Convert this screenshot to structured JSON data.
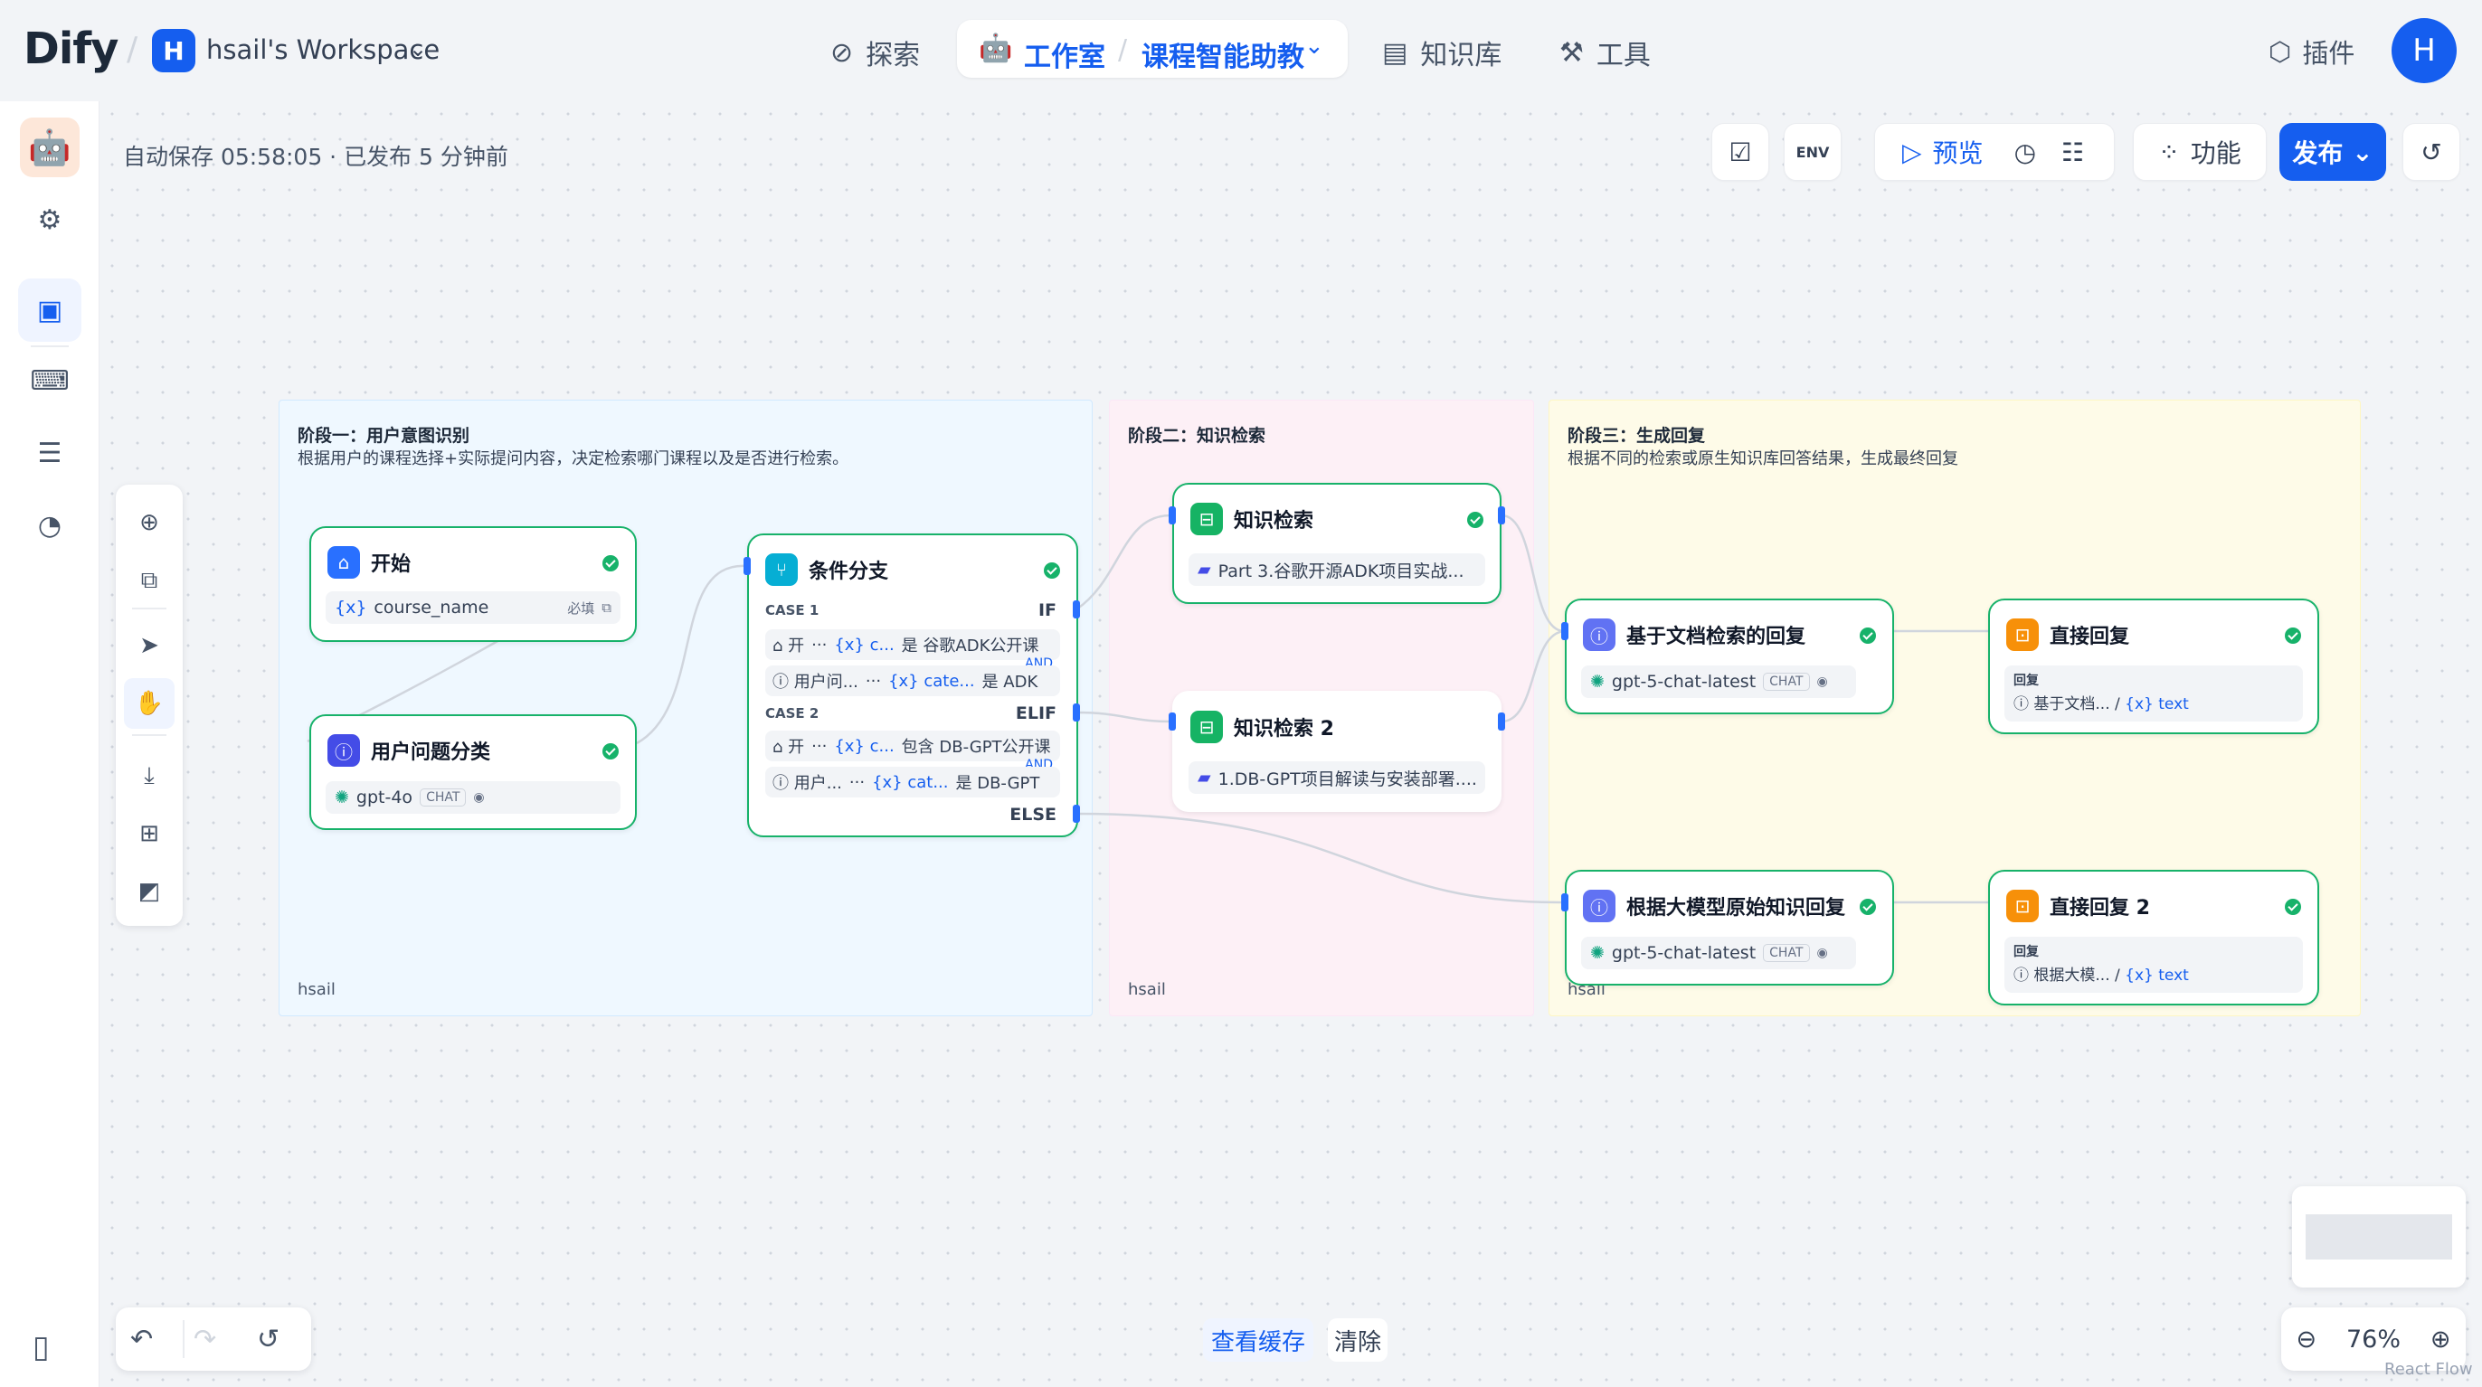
{
  "brand": {
    "logo": "Dify"
  },
  "workspace": {
    "initial": "H",
    "name": "hsail's Workspace"
  },
  "nav": {
    "explore": "探索",
    "studio": "工作室",
    "app_name": "课程智能助教",
    "knowledge": "知识库",
    "tools": "工具",
    "plugins": "插件"
  },
  "user": {
    "initial": "H"
  },
  "status": {
    "autosave": "自动保存 05:58:05 · 已发布 5 分钟前"
  },
  "toolbar": {
    "env": "ENV",
    "preview": "预览",
    "features": "功能",
    "publish": "发布"
  },
  "groups": [
    {
      "title": "阶段一：用户意图识别",
      "desc": "根据用户的课程选择+实际提问内容，决定检索哪门课程以及是否进行检索。",
      "author": "hsail"
    },
    {
      "title": "阶段二：知识检索",
      "desc": "",
      "author": "hsail"
    },
    {
      "title": "阶段三：生成回复",
      "desc": "根据不同的检索或原生知识库回答结果，生成最终回复",
      "author": "hsail"
    }
  ],
  "nodes": {
    "start": {
      "title": "开始",
      "var_icon": "{x}",
      "var": "course_name",
      "required": "必填"
    },
    "classifier": {
      "title": "用户问题分类",
      "model": "gpt-4o",
      "mode": "CHAT"
    },
    "ifelse": {
      "title": "条件分支",
      "case1": "CASE 1",
      "if": "IF",
      "c1r1_a": "⌂ 开",
      "c1r1_dots": "···",
      "c1r1_var": "{x} c...",
      "c1r1_op": "是 谷歌ADK公开课",
      "and": "AND",
      "c1r2_a": "ⓘ 用户问...",
      "c1r2_dots": "···",
      "c1r2_var": "{x} cate...",
      "c1r2_op": "是 ADK",
      "case2": "CASE 2",
      "elif": "ELIF",
      "c2r1_a": "⌂ 开",
      "c2r1_dots": "···",
      "c2r1_var": "{x} c...",
      "c2r1_op": "包含 DB-GPT公开课",
      "c2r2_a": "ⓘ 用户...",
      "c2r2_dots": "···",
      "c2r2_var": "{x} cat...",
      "c2r2_op": "是 DB-GPT",
      "else": "ELSE"
    },
    "kr1": {
      "title": "知识检索",
      "dataset": "Part 3.谷歌开源ADK项目实战..."
    },
    "kr2": {
      "title": "知识检索 2",
      "dataset": "1.DB-GPT项目解读与安装部署...."
    },
    "llm1": {
      "title": "基于文档检索的回复",
      "model": "gpt-5-chat-latest",
      "mode": "CHAT"
    },
    "llm2": {
      "title": "根据大模型原始知识回复",
      "model": "gpt-5-chat-latest",
      "mode": "CHAT"
    },
    "ans1": {
      "title": "直接回复",
      "label": "回复",
      "src": "ⓘ 基于文档...",
      "var": "{x} text"
    },
    "ans2": {
      "title": "直接回复 2",
      "label": "回复",
      "src": "ⓘ 根据大模...",
      "var": "{x} text"
    }
  },
  "bottom": {
    "view_cache": "查看缓存",
    "clear": "清除",
    "zoom": "76%",
    "react_flow": "React Flow"
  },
  "colors": {
    "accent": "#155eef",
    "success": "#17b26a",
    "group1": "#eff8ff",
    "group2": "#fdf0f6",
    "group3": "#fefbe8"
  }
}
